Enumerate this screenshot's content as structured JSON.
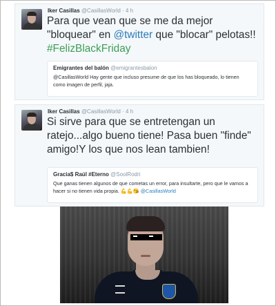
{
  "tweets": [
    {
      "author": "Iker Casillas",
      "handle": "@CasillasWorld",
      "sep": "·",
      "time": "4 h",
      "text_plain_1": "Para que vean que se me da mejor \"bloquear\" en ",
      "text_link": "@twitter",
      "text_plain_2": " que \"blocar\" pelotas!! ",
      "text_hashtag": "#FelizBlackFriday",
      "quote": {
        "author": "Emigrantes del balón",
        "handle": "@emigrantesbalon",
        "text": "@CasillasWorld Hay gente que incluso presume de que los has bloqueado, lo tienen como imagen de perfil, jaja."
      }
    },
    {
      "author": "Iker Casillas",
      "handle": "@CasillasWorld",
      "sep": "·",
      "time": "4 h",
      "text": "Si sirve para que se entretengan un ratejo...algo bueno tiene! Pasa buen \"finde\" amigo!Y los que nos lean tambien!",
      "quote": {
        "author": "Gracia$ Raúl #Eterno",
        "handle": "@SoolRodri",
        "text_plain": "Que ganas tienen algunos de que cometas un error, para insultarte, pero que le vamos a hacer si no tienen vida propia. ",
        "emoji": "💪💪😘",
        "text_link": " @CasillasWorld"
      }
    }
  ],
  "icons": {
    "avatar": "avatar-icon",
    "photo": "meme-photo"
  },
  "colors": {
    "link": "#2b7bb9",
    "hashtag": "#3b9e58",
    "muted": "#8899a6",
    "tweet_bg": "#f5f8fa"
  }
}
